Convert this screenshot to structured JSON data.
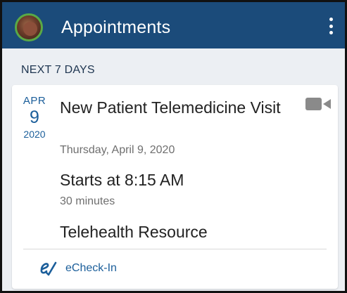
{
  "header": {
    "title": "Appointments",
    "avatar_icon": "user-photo",
    "menu_icon": "more-vertical-icon",
    "background_color": "#1b4b7a"
  },
  "section": {
    "label": "NEXT 7 DAYS"
  },
  "appointment": {
    "month": "APR",
    "day": "9",
    "year": "2020",
    "title": "New Patient Telemedicine Visit",
    "date_full": "Thursday, April 9, 2020",
    "start_time": "Starts at 8:15 AM",
    "duration": "30 minutes",
    "resource": "Telehealth Resource",
    "type_icon": "video-camera-icon"
  },
  "actions": {
    "echeckin_label": "eCheck-In",
    "echeckin_icon": "echeckin-icon",
    "accent_color": "#1b5e9a"
  }
}
